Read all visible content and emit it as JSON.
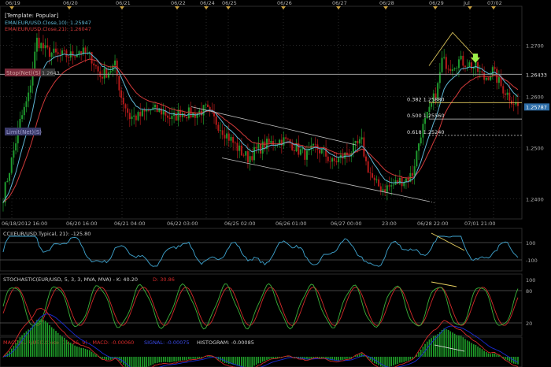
{
  "template": "[Template: Popular]",
  "dates_top": [
    "06/19",
    "06/20",
    "06/21",
    "06/22",
    "06/24",
    "06/25",
    "06/26",
    "06/27",
    "06/28",
    "06/29",
    "Jul",
    "07/02"
  ],
  "dates_bottom": [
    "06/18/2012 16:00",
    "06/20 16:00",
    "06/21 04:00",
    "06/22 03:00",
    "06/25 02:00",
    "06/26 01:00",
    "06/27 00:00",
    "23:00",
    "06/28 22:00",
    "07/01 21:00"
  ],
  "colors": {
    "background": "#000000",
    "candle_up": "#1f9a2e",
    "candle_down": "#b51a1a",
    "ema10": "#5fb8d6",
    "ema21": "#d23a3a",
    "grid": "#2a2a2a",
    "trend": "#bfbfbf",
    "fib": "#cfcfcf",
    "fib_yellow": "#e8d060",
    "stop_label": "#7a2a3a",
    "limit_label": "#3a3a6a",
    "cci": "#3fa5d0",
    "stoch_k": "#3ab23a",
    "stoch_d": "#d22a2a",
    "macd": "#d22a2a",
    "signal": "#1b2bd6",
    "histogram": "#1fa02a",
    "arrow": "#9cf04a",
    "price_box": "#2e6ea8"
  },
  "main": {
    "legend_ema10": "EMA(EUR/USD.Close,10): 1.25947",
    "legend_ema21": "EMA(EUR/USD.Close,21): 1.26047",
    "stop_label": "Stop(Net)(S)",
    "stop_value": "1.2643",
    "limit_label": "Limit(Net)(S)",
    "axis_ticks": [
      "1.2700",
      "1.2600",
      "1.2500",
      "1.2400"
    ],
    "fib_levels": [
      {
        "label": "0.382 1.25880"
      },
      {
        "label": "0.500 1.25560"
      },
      {
        "label": "0.618 1.25240"
      }
    ],
    "stop_line_value": "1.26433",
    "current_price": "1.25787"
  },
  "cci": {
    "legend": "CCI(EUR/USD.Typical, 21): -125.80",
    "axis_ticks": [
      "100",
      "-100"
    ]
  },
  "stochastic": {
    "legend_main": "STOCHASTIC(EUR/USD, 5, 3, 3, MVA, MVA) - K: 40.20",
    "legend_d": "D: 30.86",
    "axis_ticks": [
      "100",
      "80",
      "20"
    ]
  },
  "macd": {
    "legend_main": "MACD(EUR/USD.Close, 12, 26, 9) - MACD: -0.00060",
    "legend_signal": "SIGNAL: -0.00075",
    "legend_hist": "HISTOGRAM: -0.00085"
  },
  "chart_data": {
    "type": "candlestick",
    "symbol": "EUR/USD",
    "ylim": [
      1.237,
      1.277
    ],
    "waypoints": [
      [
        0,
        1.2405
      ],
      [
        4,
        1.2475
      ],
      [
        8,
        1.255
      ],
      [
        12,
        1.26
      ],
      [
        16,
        1.271
      ],
      [
        20,
        1.269
      ],
      [
        26,
        1.268
      ],
      [
        32,
        1.268
      ],
      [
        36,
        1.269
      ],
      [
        42,
        1.2675
      ],
      [
        46,
        1.264
      ],
      [
        50,
        1.265
      ],
      [
        53,
        1.266
      ],
      [
        56,
        1.26
      ],
      [
        60,
        1.256
      ],
      [
        64,
        1.256
      ],
      [
        70,
        1.2575
      ],
      [
        76,
        1.257
      ],
      [
        80,
        1.2555
      ],
      [
        84,
        1.257
      ],
      [
        90,
        1.2565
      ],
      [
        96,
        1.2575
      ],
      [
        100,
        1.2555
      ],
      [
        104,
        1.2535
      ],
      [
        108,
        1.2515
      ],
      [
        112,
        1.2495
      ],
      [
        116,
        1.248
      ],
      [
        120,
        1.2495
      ],
      [
        124,
        1.2505
      ],
      [
        128,
        1.251
      ],
      [
        132,
        1.2515
      ],
      [
        136,
        1.251
      ],
      [
        140,
        1.2495
      ],
      [
        144,
        1.2485
      ],
      [
        148,
        1.25
      ],
      [
        152,
        1.249
      ],
      [
        156,
        1.247
      ],
      [
        160,
        1.248
      ],
      [
        164,
        1.249
      ],
      [
        168,
        1.2505
      ],
      [
        170,
        1.251
      ],
      [
        172,
        1.247
      ],
      [
        176,
        1.243
      ],
      [
        180,
        1.242
      ],
      [
        184,
        1.2425
      ],
      [
        188,
        1.2435
      ],
      [
        192,
        1.244
      ],
      [
        194,
        1.245
      ],
      [
        198,
        1.253
      ],
      [
        202,
        1.257
      ],
      [
        206,
        1.262
      ],
      [
        208,
        1.267
      ],
      [
        212,
        1.266
      ],
      [
        216,
        1.267
      ],
      [
        220,
        1.2665
      ],
      [
        224,
        1.2655
      ],
      [
        228,
        1.2635
      ],
      [
        232,
        1.265
      ],
      [
        236,
        1.262
      ],
      [
        240,
        1.26
      ],
      [
        244,
        1.258
      ]
    ],
    "candles": 245,
    "series_legends": [
      "EMA(EUR/USD.Close,10): 1.25947",
      "EMA(EUR/USD.Close,21): 1.26047"
    ],
    "trend_upper": [
      [
        1.258
      ],
      [
        1.2505
      ]
    ],
    "trend_lower": [
      [
        1.248
      ],
      [
        1.2395
      ]
    ],
    "fibonacci": [
      {
        "ratio": 0.382,
        "price": 1.2588
      },
      {
        "ratio": 0.5,
        "price": 1.2556
      },
      {
        "ratio": 0.618,
        "price": 1.2524
      }
    ],
    "stop_price": 1.26433,
    "last_price": 1.25787,
    "cci_value": -125.8,
    "stoch_k": 40.2,
    "stoch_d": 30.86,
    "macd": -0.0006,
    "macd_signal": -0.00075,
    "macd_histogram": -0.00085,
    "cci_ylim": [
      -250,
      250
    ],
    "stoch_ylim": [
      0,
      100
    ],
    "macd_ylim": [
      -0.004,
      0.004
    ]
  }
}
